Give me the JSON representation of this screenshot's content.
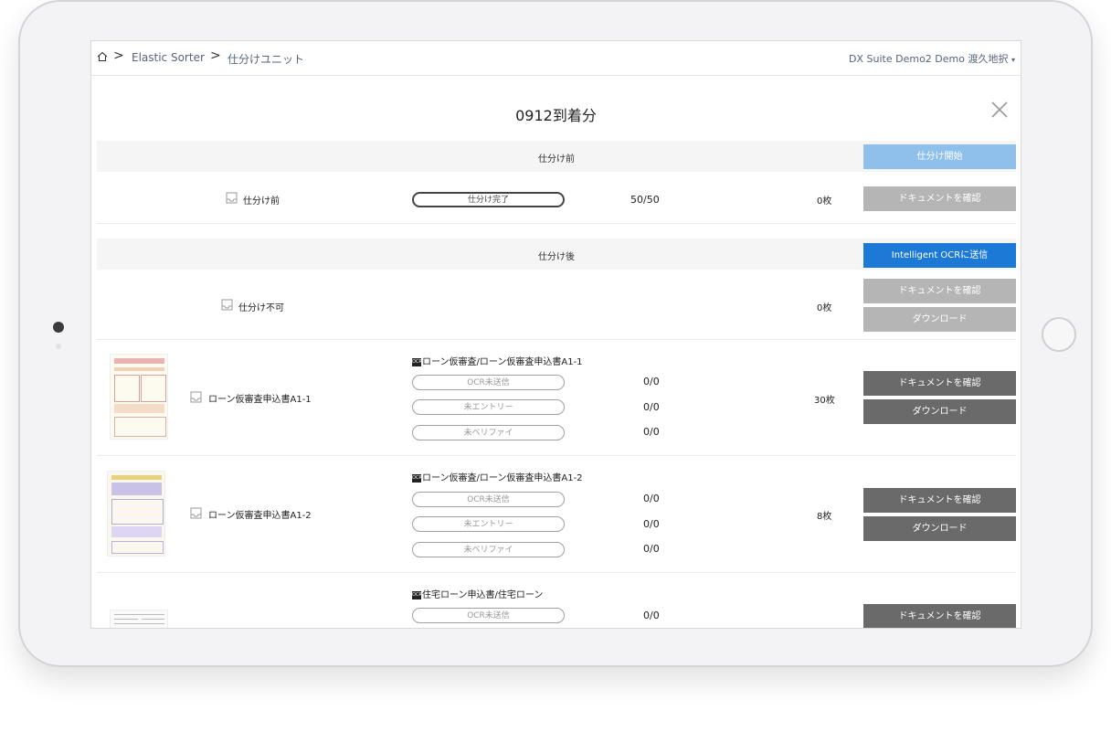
{
  "breadcrumb": [
    "Elastic Sorter",
    "仕分けユニット"
  ],
  "user": "DX Suite Demo2 Demo 渡久地択",
  "title": "0912到着分",
  "before": {
    "header": "仕分け前",
    "action": "仕分け開始",
    "row": {
      "name": "仕分け前",
      "status": "仕分け完了",
      "progress": "50/50",
      "count": "0枚",
      "confirm": "ドキュメントを確認"
    }
  },
  "after": {
    "header": "仕分け後",
    "action": "Intelligent OCRに送信",
    "unsortable": {
      "name": "仕分け不可",
      "count": "0枚",
      "confirm": "ドキュメントを確認",
      "download": "ダウンロード"
    },
    "rows": [
      {
        "name": "ローン仮審査申込書A1-1",
        "ocr_label": "OCR",
        "title": "ローン仮審査/ローン仮審査申込書A1-1",
        "statuses": [
          "OCR未送信",
          "未エントリー",
          "未ベリファイ"
        ],
        "counts": [
          "0/0",
          "0/0",
          "0/0"
        ],
        "count": "30枚",
        "confirm": "ドキュメントを確認",
        "download": "ダウンロード"
      },
      {
        "name": "ローン仮審査申込書A1-2",
        "ocr_label": "OCR",
        "title": "ローン仮審査/ローン仮審査申込書A1-2",
        "statuses": [
          "OCR未送信",
          "未エントリー",
          "未ベリファイ"
        ],
        "counts": [
          "0/0",
          "0/0",
          "0/0"
        ],
        "count": "8枚",
        "confirm": "ドキュメントを確認",
        "download": "ダウンロード"
      },
      {
        "ocr_label": "OCR",
        "title": "住宅ローン申込書/住宅ローン",
        "statuses": [
          "OCR未送信"
        ],
        "counts": [
          "0/0"
        ],
        "confirm": "ドキュメントを確認"
      }
    ]
  }
}
